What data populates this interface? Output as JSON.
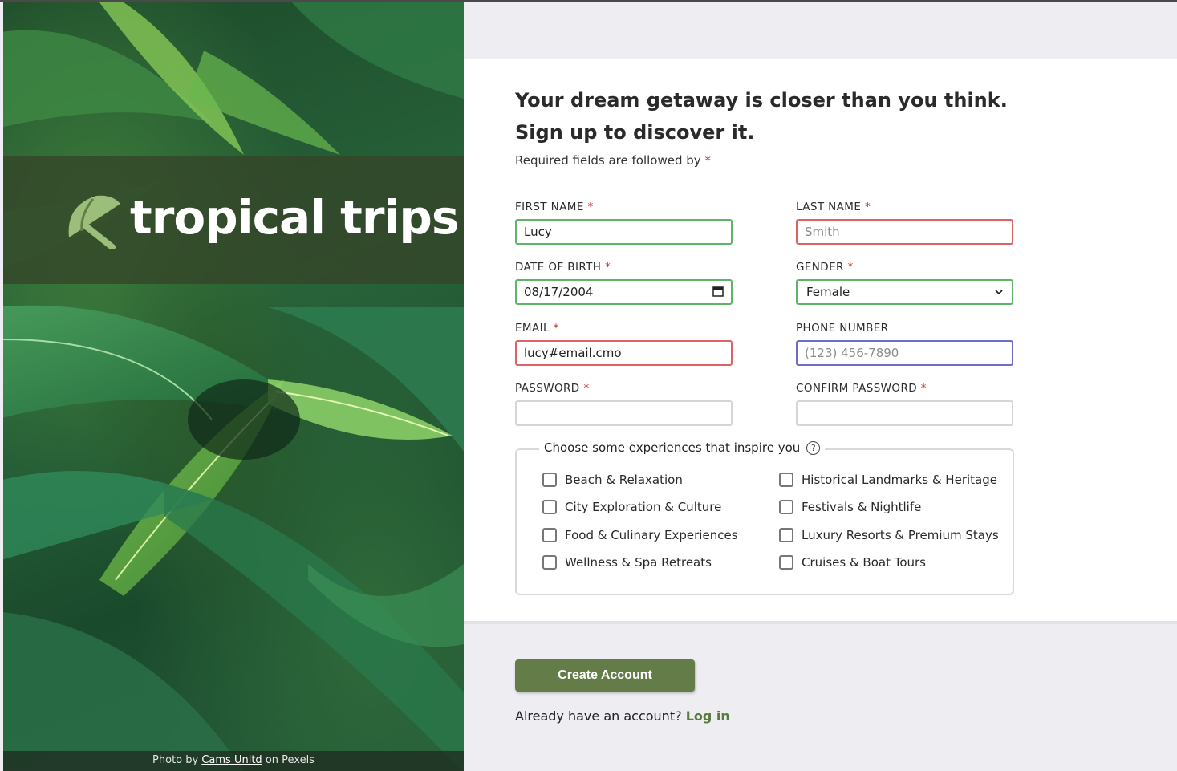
{
  "brand": {
    "name": "tropical trips",
    "logo_icon": "umbrella-icon"
  },
  "photo_credit": {
    "prefix": "Photo by",
    "author": "Cams Unltd",
    "suffix": "on Pexels"
  },
  "heading": {
    "line1": "Your dream getaway is closer than you think.",
    "line2": "Sign up to discover it."
  },
  "required_note": "Required fields are followed by",
  "required_marker": "*",
  "fields": {
    "first_name": {
      "label": "FIRST NAME",
      "value": "Lucy",
      "placeholder": "",
      "state": "valid"
    },
    "last_name": {
      "label": "LAST NAME",
      "value": "",
      "placeholder": "Smith",
      "state": "invalid"
    },
    "dob": {
      "label": "DATE OF BIRTH",
      "value": "08/17/2004",
      "state": "valid"
    },
    "gender": {
      "label": "GENDER",
      "value": "Female",
      "state": "valid"
    },
    "email": {
      "label": "EMAIL",
      "value": "lucy#email.cmo",
      "placeholder": "",
      "state": "invalid"
    },
    "phone": {
      "label": "PHONE NUMBER",
      "value": "",
      "placeholder": "(123) 456-7890",
      "state": "focused"
    },
    "password": {
      "label": "PASSWORD",
      "value": ""
    },
    "confirm_password": {
      "label": "CONFIRM PASSWORD",
      "value": ""
    }
  },
  "experiences": {
    "legend": "Choose some experiences that inspire you",
    "help_icon": "question-circle-icon",
    "options": [
      {
        "label": "Beach & Relaxation",
        "checked": false
      },
      {
        "label": "Historical Landmarks & Heritage",
        "checked": false
      },
      {
        "label": "City Exploration & Culture",
        "checked": false
      },
      {
        "label": "Festivals & Nightlife",
        "checked": false
      },
      {
        "label": "Food & Culinary Experiences",
        "checked": false
      },
      {
        "label": "Luxury Resorts & Premium Stays",
        "checked": false
      },
      {
        "label": "Wellness & Spa Retreats",
        "checked": false
      },
      {
        "label": "Cruises & Boat Tours",
        "checked": false
      }
    ]
  },
  "submit_label": "Create Account",
  "login": {
    "prompt": "Already have an account?",
    "link": "Log in"
  },
  "colors": {
    "brand_green": "#647d48",
    "valid_border": "#5fb46a",
    "invalid_border": "#dc6464",
    "focus_border": "#6a6ec8",
    "required_star": "#cc2b2b"
  }
}
